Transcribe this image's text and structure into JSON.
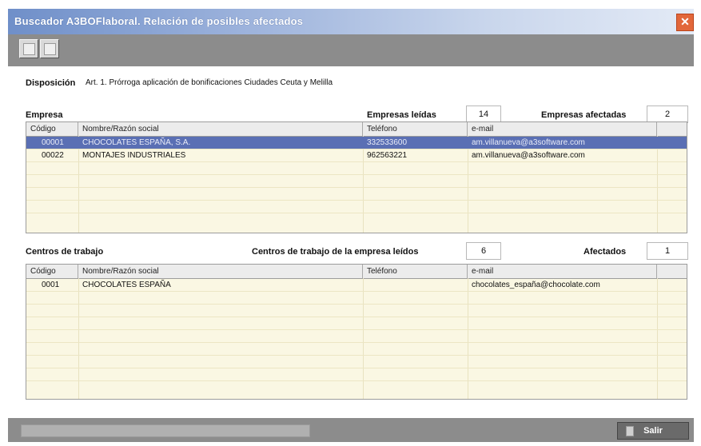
{
  "window": {
    "title": "Buscador A3BOFlaboral. Relación de posibles afectados",
    "close_glyph": "✕"
  },
  "toolbar": {
    "buttons": [
      {
        "icon": "print-icon"
      },
      {
        "icon": "preview-icon"
      }
    ]
  },
  "disposicion": {
    "label": "Disposición",
    "value": "Art. 1. Prórroga aplicación de bonificaciones Ciudades Ceuta y Melilla"
  },
  "empresa": {
    "section_label": "Empresa",
    "leidas_label": "Empresas leídas",
    "leidas_value": "14",
    "afectadas_label": "Empresas afectadas",
    "afectadas_value": "2",
    "columns": [
      "Código",
      "Nombre/Razón social",
      "Teléfono",
      "e-mail"
    ],
    "rows": [
      {
        "codigo": "00001",
        "nombre": "CHOCOLATES ESPAÑA, S.A.",
        "telefono": "332533600",
        "email": "am.villanueva@a3software.com",
        "selected": true
      },
      {
        "codigo": "00022",
        "nombre": "MONTAJES INDUSTRIALES",
        "telefono": "962563221",
        "email": "am.villanueva@a3software.com",
        "selected": false
      }
    ]
  },
  "centros": {
    "section_label": "Centros de trabajo",
    "leidos_label": "Centros de trabajo de la empresa leídos",
    "leidos_value": "6",
    "afectados_label": "Afectados",
    "afectados_value": "1",
    "columns": [
      "Código",
      "Nombre/Razón social",
      "Teléfono",
      "e-mail"
    ],
    "rows": [
      {
        "codigo": "0001",
        "nombre": "CHOCOLATES ESPAÑA",
        "telefono": "",
        "email": "chocolates_españa@chocolate.com"
      }
    ]
  },
  "footer": {
    "salir_label": "Salir",
    "progress": 0
  },
  "colors": {
    "grid_bg": "#faf7e3",
    "selected_row": "#5a6fb4",
    "title_gradient_start": "#6f8fc9"
  }
}
